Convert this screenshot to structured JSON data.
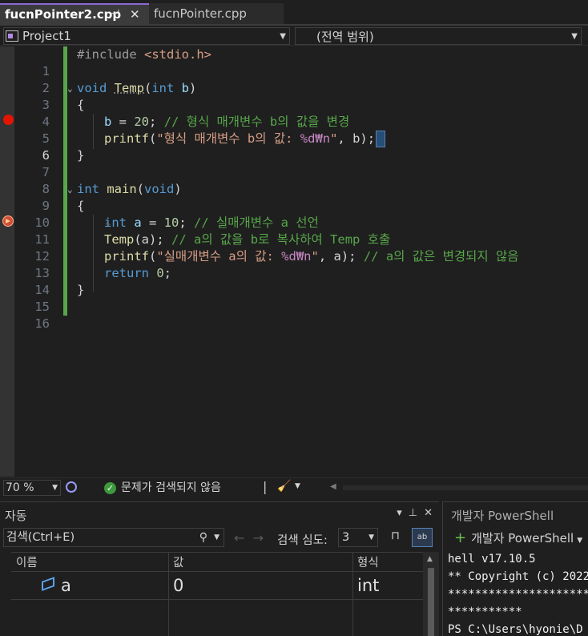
{
  "tabs": [
    {
      "label": "fucnPointer2.cpp",
      "active": true
    },
    {
      "label": "fucnPointer.cpp",
      "active": false
    }
  ],
  "navbar": {
    "project": "Project1",
    "scope": "(전역 범위)"
  },
  "editor": {
    "line_numbers": [
      "1",
      "2",
      "3",
      "4",
      "5",
      "6",
      "7",
      "8",
      "9",
      "10",
      "11",
      "12",
      "13",
      "14",
      "15",
      "16"
    ],
    "code": {
      "l1_pre": "#include ",
      "l1_inc": "<stdio.h>",
      "l3_kw": "void",
      "l3_fn": "Temp",
      "l3_open": "(",
      "l3_type": "int",
      "l3_param": " b",
      "l3_close": ")",
      "l4": "{",
      "l5_var": "b",
      "l5_eq": " = ",
      "l5_num": "20",
      "l5_semi": ";",
      "l5_cm": " // 형식 매개변수 b의 값을 변경",
      "l6_fn": "printf",
      "l6_open": "(",
      "l6_str": "\"형식 매개변수 b의 값: ",
      "l6_fmt": "%d₩n",
      "l6_strend": "\"",
      "l6_rest": ", b)",
      "l6_semi": ";",
      "l7": "}",
      "l9_kw": "int",
      "l9_fn": " main",
      "l9_open": "(",
      "l9_void": "void",
      "l9_close": ")",
      "l10": "{",
      "l11_kw": "int",
      "l11_var": " a",
      "l11_eq": " = ",
      "l11_num": "10",
      "l11_semi": ";",
      "l11_cm": " // 실매개변수 a 선언",
      "l12_fn": "Temp",
      "l12_rest": "(a);",
      "l12_cm": " // a의 값을 b로 복사하여 Temp 호출",
      "l13_fn": "printf",
      "l13_open": "(",
      "l13_str": "\"실매개변수 a의 값: ",
      "l13_fmt": "%d₩n",
      "l13_strend": "\"",
      "l13_rest": ", a);",
      "l13_cm": " // a의 값은 변경되지 않음",
      "l14_kw": "return",
      "l14_num": " 0",
      "l14_semi": ";",
      "l15": "}"
    }
  },
  "statusbar": {
    "zoom": "70 %",
    "issues": "문제가 검색되지 않음"
  },
  "autos": {
    "title": "자동",
    "search_placeholder": "검색(Ctrl+E)",
    "depth_label": "검색 심도:",
    "depth_value": "3",
    "columns": [
      "이름",
      "값",
      "형식"
    ],
    "rows": [
      {
        "name": "a",
        "value": "0",
        "type": "int"
      }
    ]
  },
  "powershell": {
    "title": "개발자 PowerShell",
    "button": "개발자 PowerShell",
    "lines": [
      "hell v17.10.5",
      "** Copyright (c) 2022",
      "**********************",
      "***********",
      "PS C:\\Users\\hyonie\\D"
    ]
  },
  "colors": {
    "accent": "#8a6ad4",
    "breakpoint": "#e51400",
    "change_bar": "#57a64a"
  }
}
